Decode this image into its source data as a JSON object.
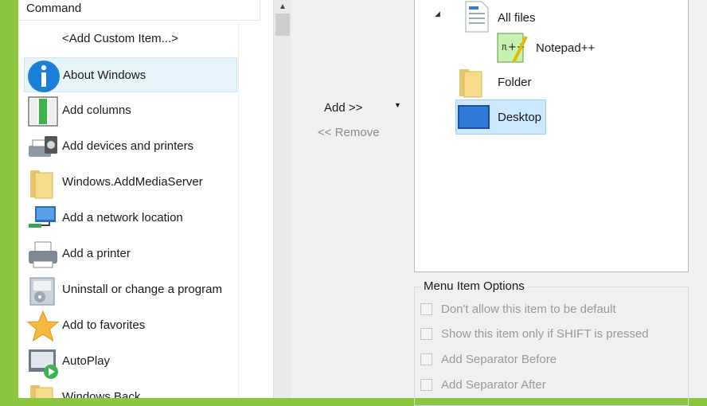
{
  "command_list": {
    "header": "Command",
    "items": [
      {
        "label": "<Add Custom Item...>",
        "icon": "none"
      },
      {
        "label": "About Windows",
        "icon": "info-icon",
        "selected": true
      },
      {
        "label": "Add columns",
        "icon": "columns-icon"
      },
      {
        "label": "Add devices and printers",
        "icon": "devices-printers-icon"
      },
      {
        "label": "Windows.AddMediaServer",
        "icon": "folder-icon"
      },
      {
        "label": "Add a network location",
        "icon": "network-location-icon"
      },
      {
        "label": "Add a printer",
        "icon": "printer-icon"
      },
      {
        "label": "Uninstall or change a program",
        "icon": "programs-icon"
      },
      {
        "label": "Add to favorites",
        "icon": "star-icon"
      },
      {
        "label": "AutoPlay",
        "icon": "autoplay-icon"
      },
      {
        "label": "Windows Back...",
        "icon": "folder-icon"
      }
    ]
  },
  "actions": {
    "add": "Add >>",
    "remove": "<< Remove"
  },
  "tree": {
    "nodes": [
      {
        "label": "All files",
        "icon": "document-icon",
        "expanded": true
      },
      {
        "label": "Notepad++",
        "icon": "notepadpp-icon"
      },
      {
        "label": "Folder",
        "icon": "folder-icon"
      },
      {
        "label": "Desktop",
        "icon": "desktop-icon",
        "selected": true
      }
    ]
  },
  "options": {
    "title": "Menu Item Options",
    "items": [
      {
        "label": "Don't allow this item to be default",
        "checked": false
      },
      {
        "label": "Show this item only if SHIFT is pressed",
        "checked": false
      },
      {
        "label": "Add Separator Before",
        "checked": false
      },
      {
        "label": "Add Separator After",
        "checked": false
      }
    ]
  },
  "colors": {
    "frame": "#8cc63f",
    "selection": "#cce8ff",
    "disabled_text": "#9a9a9a"
  }
}
